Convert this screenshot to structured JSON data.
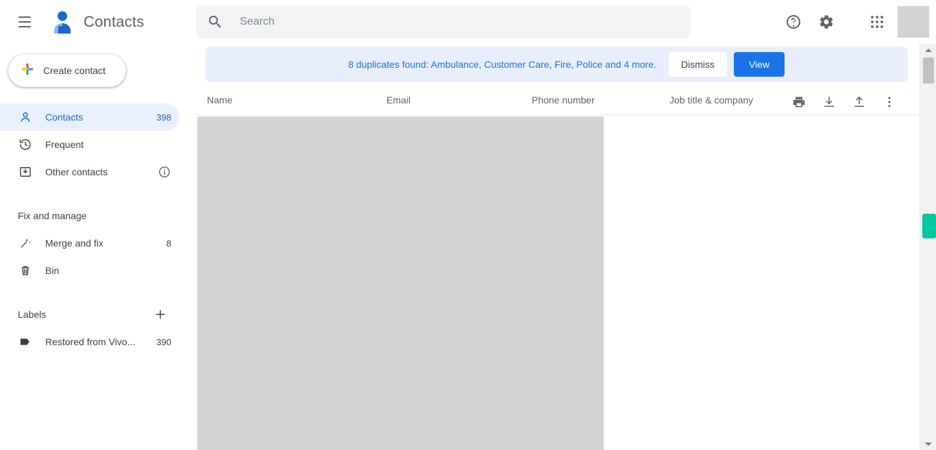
{
  "app": {
    "title": "Contacts",
    "logo_icon": "contacts-person-icon",
    "menu_icon": "hamburger-menu-icon"
  },
  "search": {
    "icon": "search-icon",
    "placeholder": "Search",
    "value": ""
  },
  "top_actions": [
    {
      "name": "help-icon",
      "label": "Help"
    },
    {
      "name": "gear-icon",
      "label": "Settings"
    },
    {
      "name": "apps-grid-icon",
      "label": "Google apps"
    },
    {
      "name": "avatar",
      "label": "Account"
    }
  ],
  "sidebar": {
    "create_button": {
      "label": "Create contact",
      "icon": "google-plus-icon"
    },
    "items": [
      {
        "label": "Contacts",
        "count": "398",
        "icon": "person-icon",
        "active": true
      },
      {
        "label": "Frequent",
        "count": "",
        "icon": "history-clock-icon",
        "active": false
      },
      {
        "label": "Other contacts",
        "count": "",
        "icon": "archive-box-icon",
        "active": false,
        "info_icon": "info-icon"
      }
    ],
    "fix_section": {
      "title": "Fix and manage",
      "items": [
        {
          "label": "Merge and fix",
          "count": "8",
          "icon": "magic-wand-icon"
        },
        {
          "label": "Bin",
          "count": "",
          "icon": "trash-bin-icon"
        }
      ]
    },
    "labels_section": {
      "title": "Labels",
      "add_icon": "plus-icon",
      "items": [
        {
          "label": "Restored from Vivo...",
          "count": "390",
          "icon": "label-tag-icon"
        }
      ]
    }
  },
  "banner": {
    "message": "8 duplicates found: Ambulance, Customer Care, Fire, Police and 4 more.",
    "dismiss_label": "Dismiss",
    "view_label": "View",
    "background": "#e8eefc",
    "link_color": "#1a73e8",
    "primary_color": "#1b73e8"
  },
  "table": {
    "columns": [
      "Name",
      "Email",
      "Phone number",
      "Job title & company"
    ],
    "actions": [
      {
        "name": "print-icon",
        "label": "Print"
      },
      {
        "name": "download-icon",
        "label": "Export"
      },
      {
        "name": "upload-icon",
        "label": "Import"
      },
      {
        "name": "more-options-icon",
        "label": "More options"
      }
    ],
    "rows": []
  },
  "scrollbar": {
    "up_icon": "scroll-up-arrow-icon",
    "down_icon": "scroll-down-arrow-icon",
    "marker_color": "#00c9a0"
  }
}
